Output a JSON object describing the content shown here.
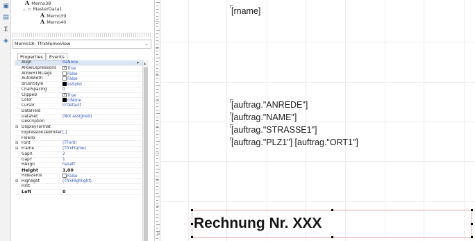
{
  "tree": {
    "items": [
      {
        "icon": "A",
        "label": "Memo38"
      },
      {
        "icon": "-",
        "label": "MasterData1"
      },
      {
        "icon": "A",
        "label": "Memo39"
      },
      {
        "icon": "A",
        "label": "Memo40"
      }
    ]
  },
  "object_selector": {
    "value": "Memo18: TfrxMemoView"
  },
  "tabs": [
    "Properties",
    "Events"
  ],
  "properties": [
    {
      "name": "Align",
      "value": "baNone",
      "dropdown": true
    },
    {
      "name": "AllowExpressions",
      "value": "True",
      "check": true
    },
    {
      "name": "AllowHTMLTags",
      "value": "False",
      "check": false
    },
    {
      "name": "AutoWidth",
      "value": "False",
      "check": false
    },
    {
      "name": "BrushStyle",
      "value": "bsSolid",
      "swatch": "#000000"
    },
    {
      "name": "CharSpacing",
      "value": "0"
    },
    {
      "name": "Clipped",
      "value": "True",
      "check": true
    },
    {
      "name": "Color",
      "value": "clNone",
      "swatch": "#000000"
    },
    {
      "name": "Cursor",
      "value": "crDefault"
    },
    {
      "name": "DataField",
      "value": ""
    },
    {
      "name": "DataSet",
      "value": "(Not assigned)"
    },
    {
      "name": "Description",
      "value": ""
    },
    {
      "name": "DisplayFormat",
      "value": "",
      "expandable": true
    },
    {
      "name": "ExpressionDelimiters",
      "value": "[,]"
    },
    {
      "name": "FlowTo",
      "value": ""
    },
    {
      "name": "Font",
      "value": "(TFont)",
      "expandable": true
    },
    {
      "name": "Frame",
      "value": "(TfrxFrame)",
      "expandable": true
    },
    {
      "name": "GapX",
      "value": "2"
    },
    {
      "name": "GapY",
      "value": "1"
    },
    {
      "name": "HAlign",
      "value": "haLeft"
    },
    {
      "name": "Height",
      "value": "1,00",
      "bold": true
    },
    {
      "name": "HideZeros",
      "value": "False",
      "check": false
    },
    {
      "name": "Highlight",
      "value": "(TfrxHighlight)",
      "expandable": true
    },
    {
      "name": "Hint",
      "value": ""
    },
    {
      "name": "Left",
      "value": "0",
      "bold": true
    }
  ],
  "ruler": {
    "labels": [
      "2",
      "3",
      "4",
      "5",
      "6",
      "7",
      "8",
      "9",
      "10"
    ]
  },
  "design": {
    "memos": [
      {
        "text": "[rname]"
      },
      {
        "text": "[auftrag.\"ANREDE\"]"
      },
      {
        "text": "[auftrag.\"NAME\"]"
      },
      {
        "text": "[auftrag.\"STRASSE1\"]"
      },
      {
        "text": "[auftrag.\"PLZ1\"] [auftrag.\"ORT1\"]"
      }
    ],
    "selected_memo": {
      "text": "Rechnung Nr. XXX"
    }
  },
  "colors": {
    "selection_border": "#e2a0a0",
    "value_text": "#2f55b4"
  }
}
